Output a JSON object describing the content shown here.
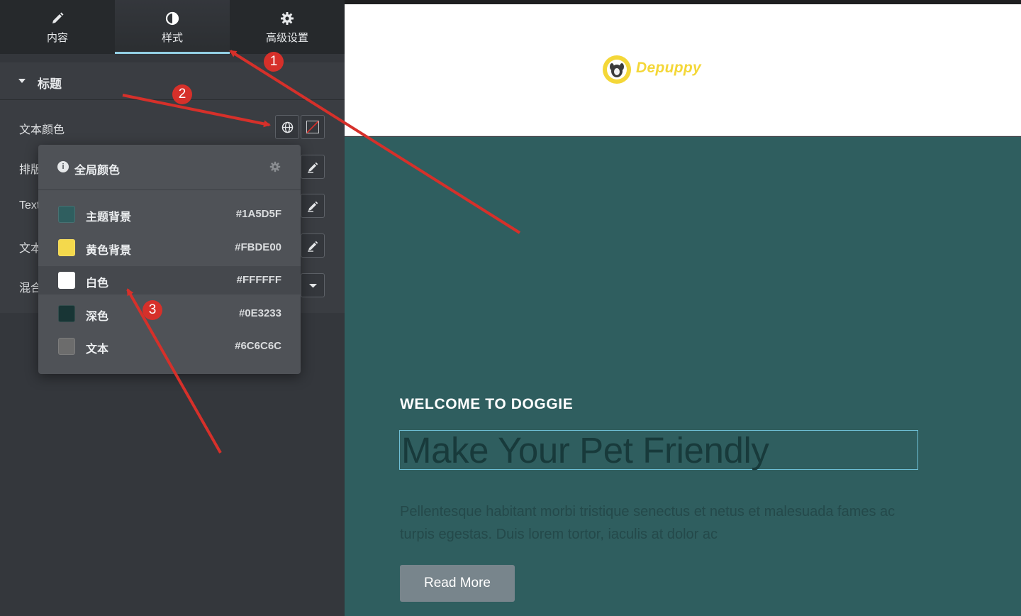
{
  "tabs": [
    {
      "label": "内容",
      "icon": "pencil-icon"
    },
    {
      "label": "样式",
      "icon": "contrast-icon",
      "active": true
    },
    {
      "label": "高级设置",
      "icon": "gear-icon"
    }
  ],
  "section": {
    "title": "标题",
    "icon": "caret-down-icon"
  },
  "controls": {
    "text_color_label": "文本颜色",
    "typography_label": "排版",
    "text_shadow_label": "Text",
    "text_stroke_label": "文本",
    "blend_mode_label": "混合"
  },
  "global_colors": {
    "title": "全局颜色",
    "items": [
      {
        "name": "主题背景",
        "hex": "#1A5D5F",
        "swatch": "#2f5e5f"
      },
      {
        "name": "黄色背景",
        "hex": "#FBDE00",
        "swatch": "#f4d94c"
      },
      {
        "name": "白色",
        "hex": "#FFFFFF",
        "swatch": "#ffffff",
        "highlighted": true
      },
      {
        "name": "深色",
        "hex": "#0E3233",
        "swatch": "#183535"
      },
      {
        "name": "文本",
        "hex": "#6C6C6C",
        "swatch": "#6c6c6c"
      }
    ]
  },
  "preview": {
    "logo_text": "Depuppy",
    "eyebrow": "WELCOME TO DOGGIE",
    "headline": "Make Your Pet Friendly",
    "body": "Pellentesque habitant morbi tristique senectus et netus et malesuada fames ac turpis egestas. Duis lorem tortor, iaculis at dolor ac",
    "button_label": "Read More"
  },
  "annotations": {
    "badges": [
      "1",
      "2",
      "3"
    ],
    "color": "#d6302a"
  },
  "colors": {
    "panel": "#34373c",
    "accent": "#93cfe4",
    "hero": "#2f5e5f",
    "logo": "#f4d738"
  }
}
